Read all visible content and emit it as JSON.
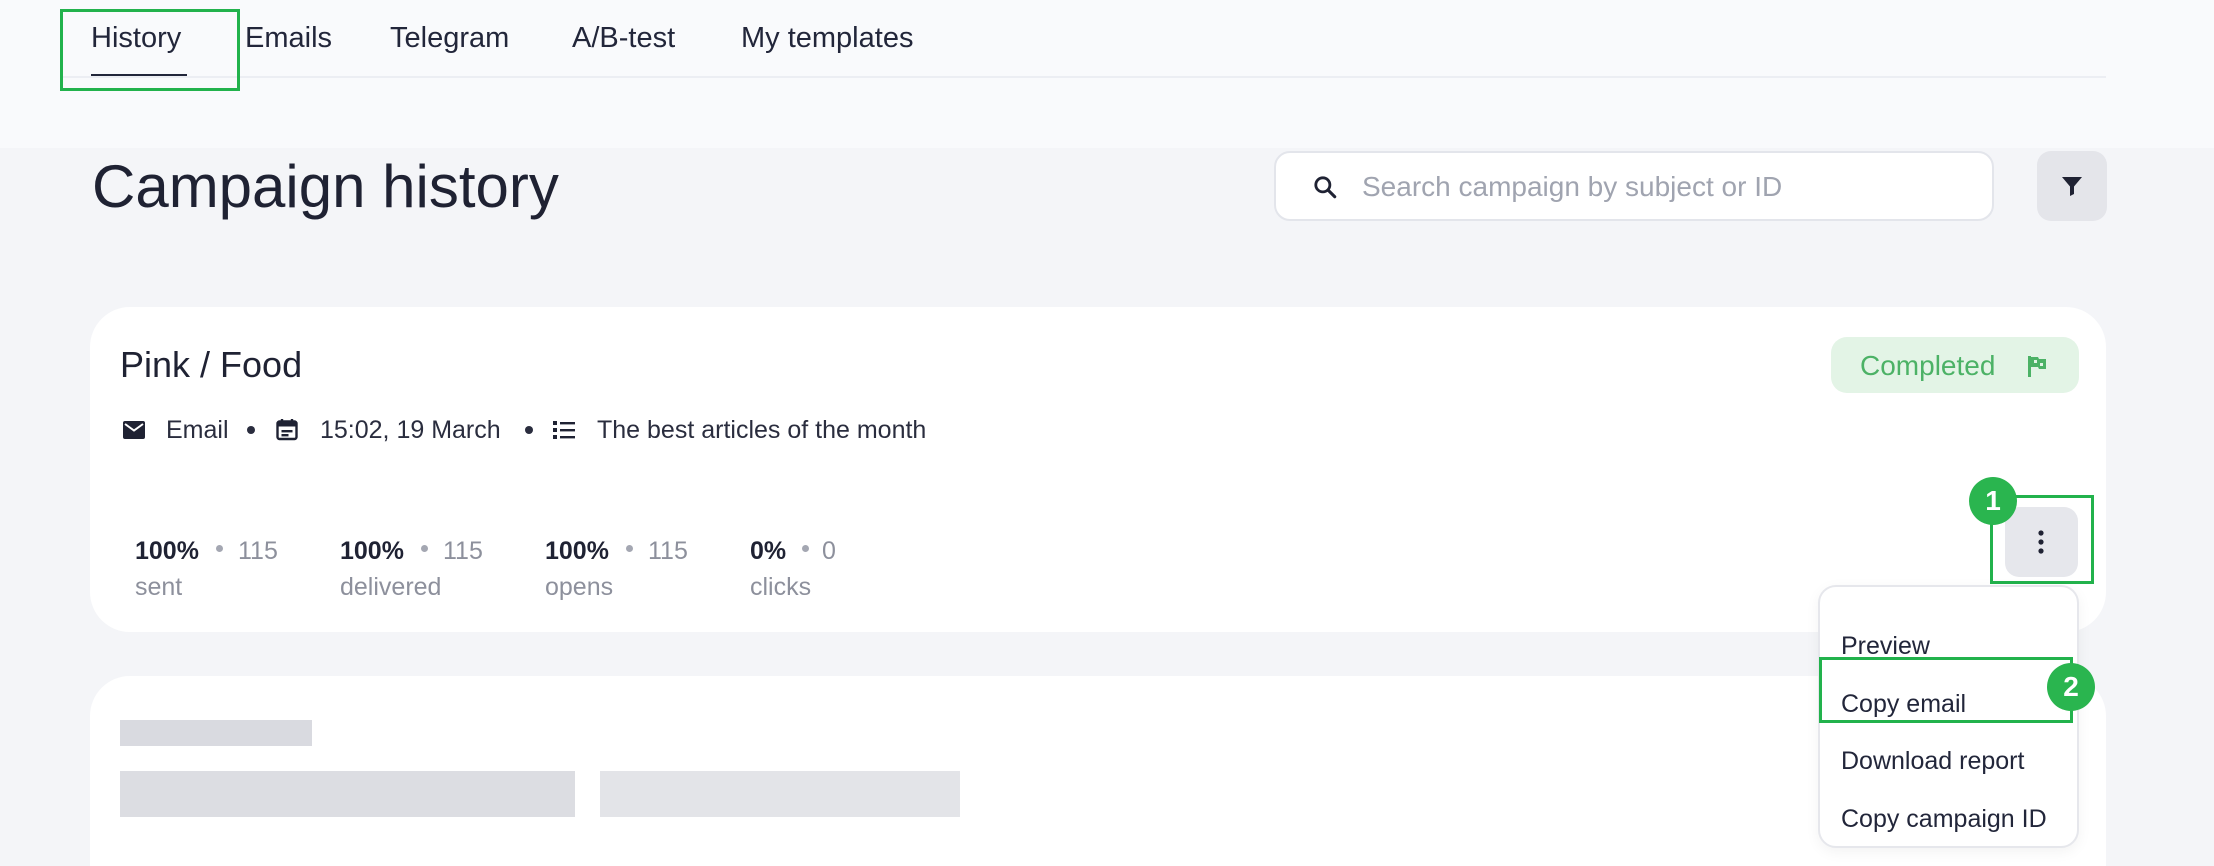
{
  "tabs": [
    {
      "label": "History",
      "active": true
    },
    {
      "label": "Emails"
    },
    {
      "label": "Telegram"
    },
    {
      "label": "A/B-test"
    },
    {
      "label": "My templates"
    }
  ],
  "page": {
    "title": "Campaign history"
  },
  "search": {
    "placeholder": "Search campaign by subject or ID",
    "icon": "search-icon"
  },
  "filter": {
    "icon": "filter-icon"
  },
  "campaign": {
    "name": "Pink / Food",
    "status": "Completed",
    "status_color": "#4cb266",
    "meta": {
      "channel": "Email",
      "datetime": "15:02, 19 March",
      "list": "The best articles of the month"
    },
    "stats": [
      {
        "pct": "100%",
        "count": "115",
        "label": "sent"
      },
      {
        "pct": "100%",
        "count": "115",
        "label": "delivered"
      },
      {
        "pct": "100%",
        "count": "115",
        "label": "opens"
      },
      {
        "pct": "0%",
        "count": "0",
        "label": "clicks"
      }
    ]
  },
  "menu": {
    "items": [
      {
        "label": "Preview"
      },
      {
        "label": "Copy email"
      },
      {
        "label": "Download report"
      },
      {
        "label": "Copy campaign ID"
      }
    ]
  },
  "callouts": {
    "first": "1",
    "second": "2"
  },
  "accent_color": "#22b24c"
}
